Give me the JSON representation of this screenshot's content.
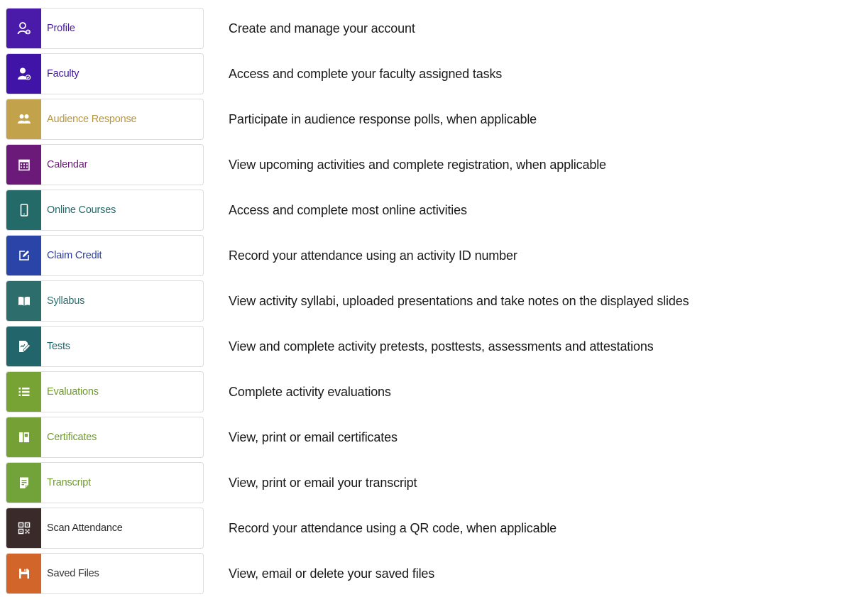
{
  "menu": [
    {
      "label": "Profile",
      "description": "Create and  manage your account",
      "icon": "user-gear-icon",
      "color": "#4a1aa8",
      "text_color": "#4a1aa8"
    },
    {
      "label": "Faculty",
      "description": "Access and complete your faculty assigned tasks",
      "icon": "user-check-icon",
      "color": "#3f14a6",
      "text_color": "#3f14a6"
    },
    {
      "label": "Audience Response",
      "description": "Participate in audience response polls, when applicable",
      "icon": "users-icon",
      "color": "#c2a24a",
      "text_color": "#b59640"
    },
    {
      "label": "Calendar",
      "description": "View upcoming  activities and complete registration, when applicable",
      "icon": "calendar-icon",
      "color": "#6b1a7a",
      "text_color": "#6b1a7a"
    },
    {
      "label": "Online Courses",
      "description": "Access and complete most online activities",
      "icon": "mobile-icon",
      "color": "#236a69",
      "text_color": "#236a69"
    },
    {
      "label": "Claim Credit",
      "description": "Record your attendance using  an activity ID number",
      "icon": "edit-icon",
      "color": "#2a44a8",
      "text_color": "#2a3f9e"
    },
    {
      "label": "Syllabus",
      "description": "View activity syllabi, uploaded  presentations and take notes on the displayed slides",
      "icon": "book-icon",
      "color": "#2d6e6c",
      "text_color": "#2d6e6c"
    },
    {
      "label": "Tests",
      "description": "View and complete activity pretests, posttests, assessments and attestations",
      "icon": "test-edit-icon",
      "color": "#22656a",
      "text_color": "#22656a"
    },
    {
      "label": "Evaluations",
      "description": "Complete activity evaluations",
      "icon": "list-icon",
      "color": "#76a333",
      "text_color": "#6f9a30"
    },
    {
      "label": "Certificates",
      "description": "View, print or email certificates",
      "icon": "certificate-icon",
      "color": "#75a035",
      "text_color": "#6f9a30"
    },
    {
      "label": "Transcript",
      "description": "View, print or email your  transcript",
      "icon": "document-icon",
      "color": "#72a23a",
      "text_color": "#6f9a30"
    },
    {
      "label": "Scan Attendance",
      "description": "Record your attendance using  a QR code, when applicable",
      "icon": "qr-code-icon",
      "color": "#3a2a2a",
      "text_color": "#2a2a2a"
    },
    {
      "label": "Saved Files",
      "description": "View, email or delete your saved files",
      "icon": "save-icon",
      "color": "#d2652a",
      "text_color": "#333333"
    }
  ]
}
